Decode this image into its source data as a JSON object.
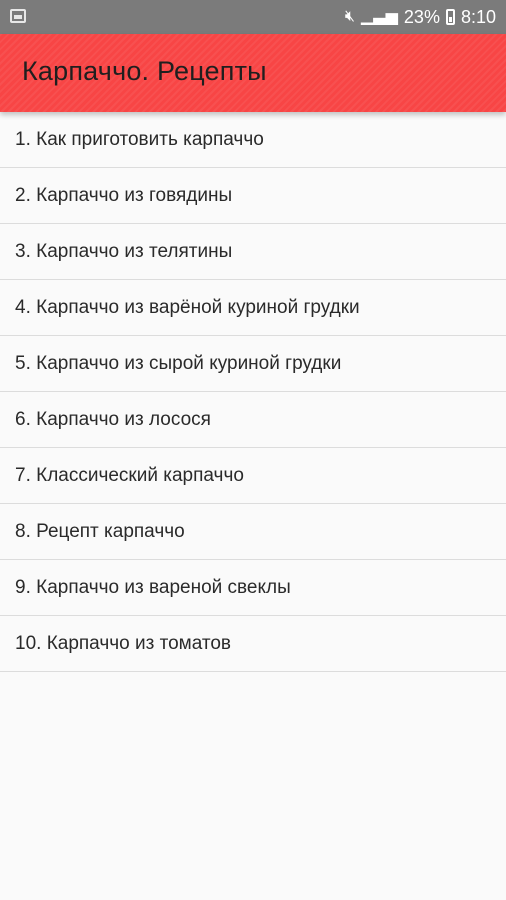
{
  "status_bar": {
    "battery_percent": "23%",
    "time": "8:10",
    "icons": [
      "gallery-notification-icon",
      "mute-icon",
      "signal-icon",
      "battery-icon"
    ]
  },
  "app_bar": {
    "title": "Карпаччо. Рецепты",
    "color": "#f84545"
  },
  "recipes": [
    "1. Как приготовить карпаччо",
    "2. Карпаччо из говядины",
    "3. Карпаччо из телятины",
    "4. Карпаччо из варёной куриной грудки",
    "5. Карпаччо из сырой куриной грудки",
    "6. Карпаччо из лосося",
    "7. Классический карпаччо",
    "8. Рецепт карпаччо",
    "9. Карпаччо из вареной свеклы",
    "10. Карпаччо из томатов"
  ]
}
